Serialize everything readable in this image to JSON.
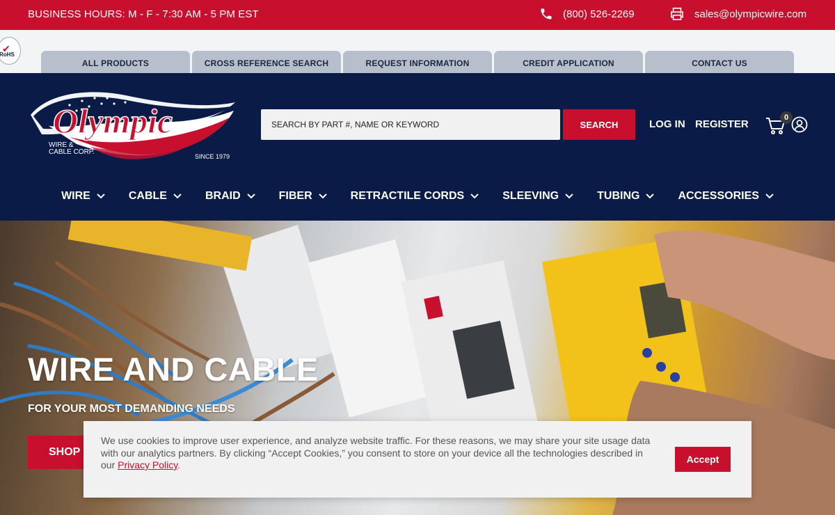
{
  "topbar": {
    "hours": "BUSINESS HOURS: M - F - 7:30 AM - 5 PM EST",
    "phone": "(800) 526-2269",
    "email": "sales@olympicwire.com"
  },
  "rohs": {
    "mark": "✔",
    "label": "RoHS"
  },
  "tabs": [
    {
      "label": "ALL PRODUCTS"
    },
    {
      "label": "CROSS REFERENCE SEARCH"
    },
    {
      "label": "REQUEST INFORMATION"
    },
    {
      "label": "CREDIT APPLICATION"
    },
    {
      "label": "CONTACT US"
    }
  ],
  "logo": {
    "name": "Olympic",
    "line1": "WIRE &",
    "line2": "CABLE CORP.",
    "since": "SINCE 1979"
  },
  "search": {
    "placeholder": "SEARCH BY PART #, NAME OR KEYWORD",
    "button": "SEARCH"
  },
  "account": {
    "login": "LOG IN",
    "register": "REGISTER",
    "cart_count": "0"
  },
  "nav": [
    {
      "label": "WIRE"
    },
    {
      "label": "CABLE"
    },
    {
      "label": "BRAID"
    },
    {
      "label": "FIBER"
    },
    {
      "label": "RETRACTILE CORDS"
    },
    {
      "label": "SLEEVING"
    },
    {
      "label": "TUBING"
    },
    {
      "label": "ACCESSORIES"
    }
  ],
  "hero": {
    "title": "WIRE AND CABLE",
    "subtitle": "FOR YOUR MOST DEMANDING NEEDS",
    "button": "SHOP N"
  },
  "cookie": {
    "text": "We use cookies to improve user experience, and analyze website traffic. For these reasons, we may share your site usage data with our analytics partners. By clicking “Accept Cookies,” you consent to store on your device all the technologies described in our ",
    "link": "Privacy Policy",
    "suffix": ".",
    "accept": "Accept"
  },
  "colors": {
    "brand_red": "#c8102e",
    "navy": "#0b1b48",
    "tab_gray": "#b8bfcc"
  }
}
